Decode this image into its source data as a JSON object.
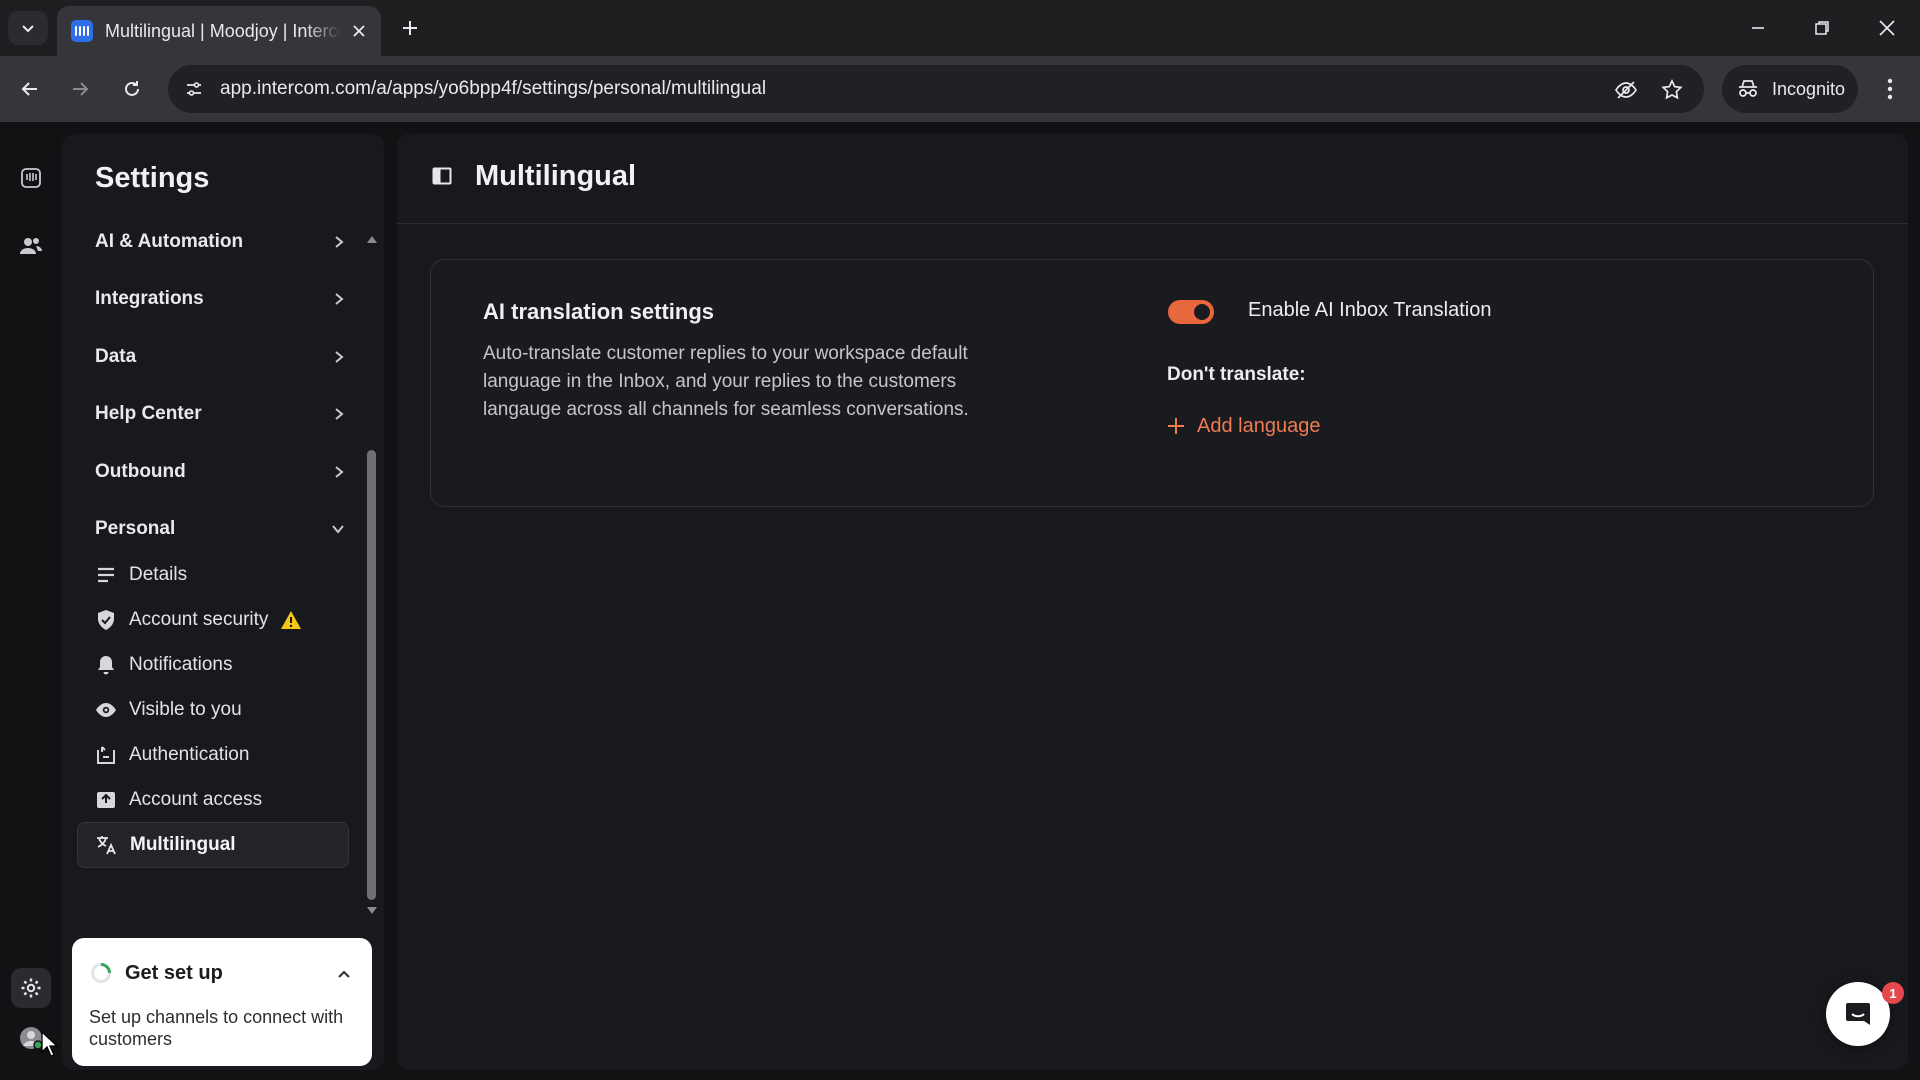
{
  "browser": {
    "tab_title": "Multilingual | Moodjoy | Intercom",
    "url": "app.intercom.com/a/apps/yo6bpp4f/settings/personal/multilingual",
    "incognito_label": "Incognito"
  },
  "settings": {
    "title": "Settings",
    "sections": [
      {
        "label": "AI & Automation"
      },
      {
        "label": "Integrations"
      },
      {
        "label": "Data"
      },
      {
        "label": "Help Center"
      },
      {
        "label": "Outbound"
      },
      {
        "label": "Personal"
      }
    ],
    "personal_items": [
      {
        "label": "Details",
        "icon": "details-icon"
      },
      {
        "label": "Account security",
        "icon": "shield-check-icon",
        "warning": true
      },
      {
        "label": "Notifications",
        "icon": "bell-icon"
      },
      {
        "label": "Visible to you",
        "icon": "eye-icon"
      },
      {
        "label": "Authentication",
        "icon": "authentication-icon"
      },
      {
        "label": "Account access",
        "icon": "account-access-icon"
      },
      {
        "label": "Multilingual",
        "icon": "translate-icon",
        "active": true
      }
    ]
  },
  "get_set_up": {
    "title": "Get set up",
    "text": "Set up channels to connect with customers"
  },
  "main": {
    "title": "Multilingual",
    "card": {
      "title": "AI translation settings",
      "description": "Auto-translate customer replies to your workspace default language in the Inbox, and your replies to the customers langauge across all channels for seamless conversations.",
      "toggle_label": "Enable AI Inbox Translation",
      "toggle_on": true,
      "dont_translate_label": "Don't translate:",
      "add_language_label": "Add language"
    }
  },
  "messenger": {
    "badge_count": "1"
  },
  "colors": {
    "accent": "#e8683d",
    "link": "#f07a52",
    "warning": "#f5c518"
  }
}
